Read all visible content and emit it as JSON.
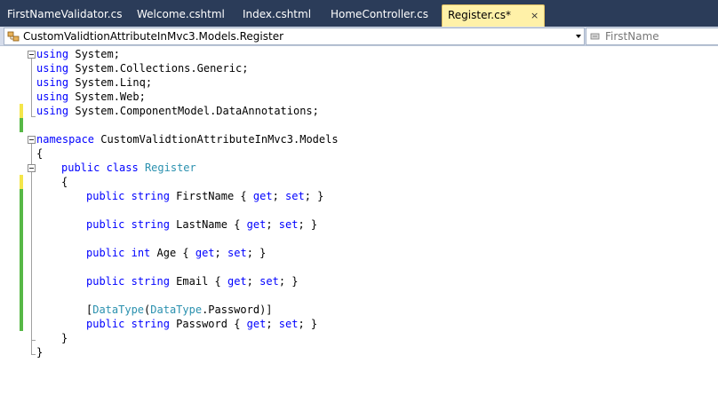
{
  "tabs": [
    {
      "label": "FirstNameValidator.cs",
      "active": false
    },
    {
      "label": "Welcome.cshtml",
      "active": false
    },
    {
      "label": "Index.cshtml",
      "active": false
    },
    {
      "label": "HomeController.cs",
      "active": false
    },
    {
      "label": "Register.cs*",
      "active": true,
      "close": "×"
    }
  ],
  "navbar": {
    "type_selector": "CustomValidtionAttributeInMvc3.Models.Register",
    "member_selector": "FirstName"
  },
  "code": {
    "l1": {
      "kw": "using",
      "rest": " System;"
    },
    "l2": {
      "kw": "using",
      "rest": " System.Collections.Generic;"
    },
    "l3": {
      "kw": "using",
      "rest": " System.Linq;"
    },
    "l4": {
      "kw": "using",
      "rest": " System.Web;"
    },
    "l5": {
      "kw": "using",
      "rest": " System.ComponentModel.DataAnnotations;"
    },
    "l7": {
      "kw": "namespace",
      "rest": " CustomValidtionAttributeInMvc3.Models"
    },
    "l8": {
      "text": "{"
    },
    "l9": {
      "kw1": "public",
      "kw2": "class",
      "type": "Register"
    },
    "l10": {
      "text": "{"
    },
    "l11": {
      "kw1": "public",
      "kw2": "string",
      "name": " FirstName { ",
      "get": "get",
      "mid": "; ",
      "set": "set",
      "end": "; }"
    },
    "l13": {
      "kw1": "public",
      "kw2": "string",
      "name": " LastName { ",
      "get": "get",
      "mid": "; ",
      "set": "set",
      "end": "; }"
    },
    "l15": {
      "kw1": "public",
      "kw2": "int",
      "name": " Age { ",
      "get": "get",
      "mid": "; ",
      "set": "set",
      "end": "; }"
    },
    "l17": {
      "kw1": "public",
      "kw2": "string",
      "name": " Email { ",
      "get": "get",
      "mid": "; ",
      "set": "set",
      "end": "; }"
    },
    "l19": {
      "open": "[",
      "attr": "DataType",
      "paren": "(",
      "enum": "DataType",
      "member": ".Password)]"
    },
    "l20": {
      "kw1": "public",
      "kw2": "string",
      "name": " Password { ",
      "get": "get",
      "mid": "; ",
      "set": "set",
      "end": "; }"
    },
    "l21": {
      "text": "}"
    },
    "l22": {
      "text": "}"
    }
  },
  "colors": {
    "keyword": "#0000ff",
    "type": "#2b91af",
    "changed_saved": "#57b846",
    "changed_unsaved": "#f4e64a",
    "tab_active": "#fff1a8",
    "tab_strip": "#2b3c59"
  }
}
